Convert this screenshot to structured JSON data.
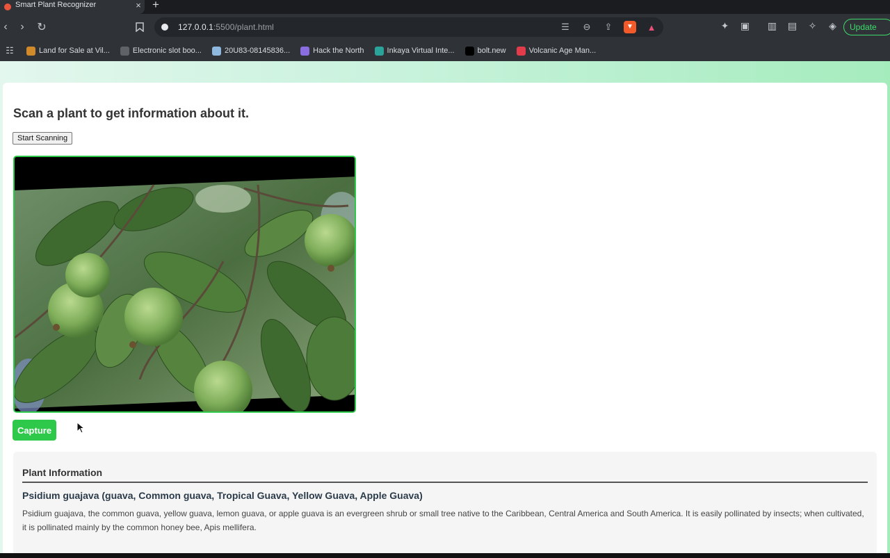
{
  "browser": {
    "tab_title": "Smart Plant Recognizer",
    "tab_close": "×",
    "new_tab": "+",
    "url_host": "127.0.0.1",
    "url_rest": ":5500/plant.html",
    "update_label": "Update",
    "bookmarks": [
      {
        "label": "Land for Sale at Vil...",
        "icon": "land-icon",
        "color": "#d08a2a"
      },
      {
        "label": "Electronic slot boo...",
        "icon": "globe-icon",
        "color": "#5f6368"
      },
      {
        "label": "20U83-08145836...",
        "icon": "image-icon",
        "color": "#8fb8de"
      },
      {
        "label": "Hack the North",
        "icon": "hack-icon",
        "color": "#8a6de0"
      },
      {
        "label": "Inkaya Virtual Inte...",
        "icon": "inkaya-icon",
        "color": "#2aa39a"
      },
      {
        "label": "bolt.new",
        "icon": "bolt-icon",
        "color": "#000000"
      },
      {
        "label": "Volcanic Age Man...",
        "icon": "t-icon",
        "color": "#e23b4a"
      }
    ]
  },
  "page": {
    "heading": "Scan a plant to get information about it.",
    "start_button": "Start Scanning",
    "capture_button": "Capture",
    "info_title": "Plant Information",
    "plant_name": "Psidium guajava (guava, Common guava, Tropical Guava, Yellow Guava, Apple Guava)",
    "plant_description": "Psidium guajava, the common guava, yellow guava, lemon guava, or apple guava is an evergreen shrub or small tree native to the Caribbean, Central America and South America. It is easily pollinated by insects; when cultivated, it is pollinated mainly by the common honey bee, Apis mellifera."
  },
  "colors": {
    "accent": "#2ec94a",
    "gradient_start": "#e3f7ee",
    "gradient_end": "#a5ecbd"
  }
}
